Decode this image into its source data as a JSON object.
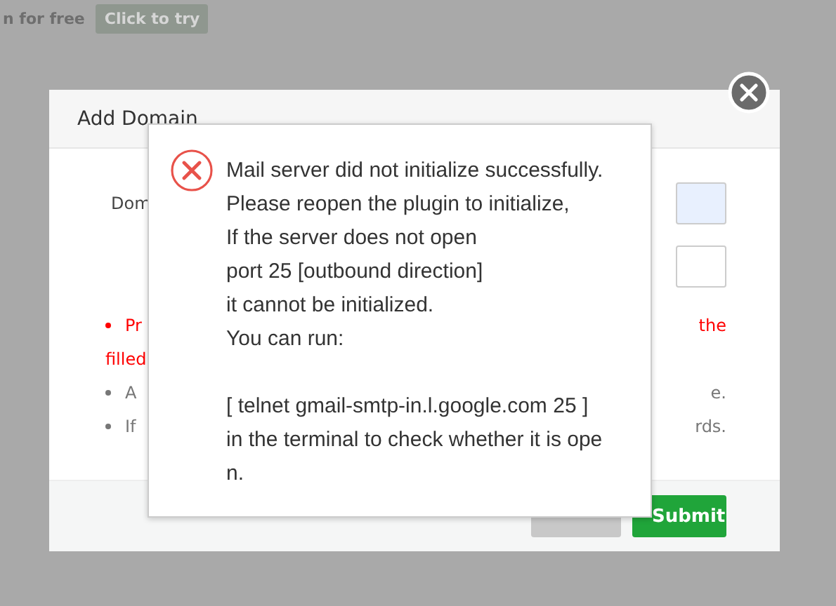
{
  "background_page": {
    "text": "n for free",
    "button": "Click to try"
  },
  "dialog": {
    "title": "Add Domain",
    "field_label": "Dom",
    "notes": [
      {
        "kind": "warning",
        "start": "Pr",
        "end": "the"
      },
      {
        "kind": "warning",
        "start": "filled"
      },
      {
        "kind": "info",
        "start": "A",
        "end": "e."
      },
      {
        "kind": "info",
        "start": "If",
        "end": "rds."
      }
    ],
    "buttons": [
      {
        "kind": "secondary"
      },
      {
        "kind": "primary",
        "label": "Submit"
      }
    ]
  },
  "alert": {
    "lines": [
      "Mail server did not initialize successfully.",
      "Please reopen the plugin to initialize,",
      "If the server does not open",
      "port 25 [outbound direction]",
      "it cannot be initialized.",
      "You can run:"
    ],
    "command_lines": [
      "[ telnet gmail-smtp-in.l.google.com 25 ]",
      "in the terminal to check whether it is ope",
      "n."
    ]
  }
}
